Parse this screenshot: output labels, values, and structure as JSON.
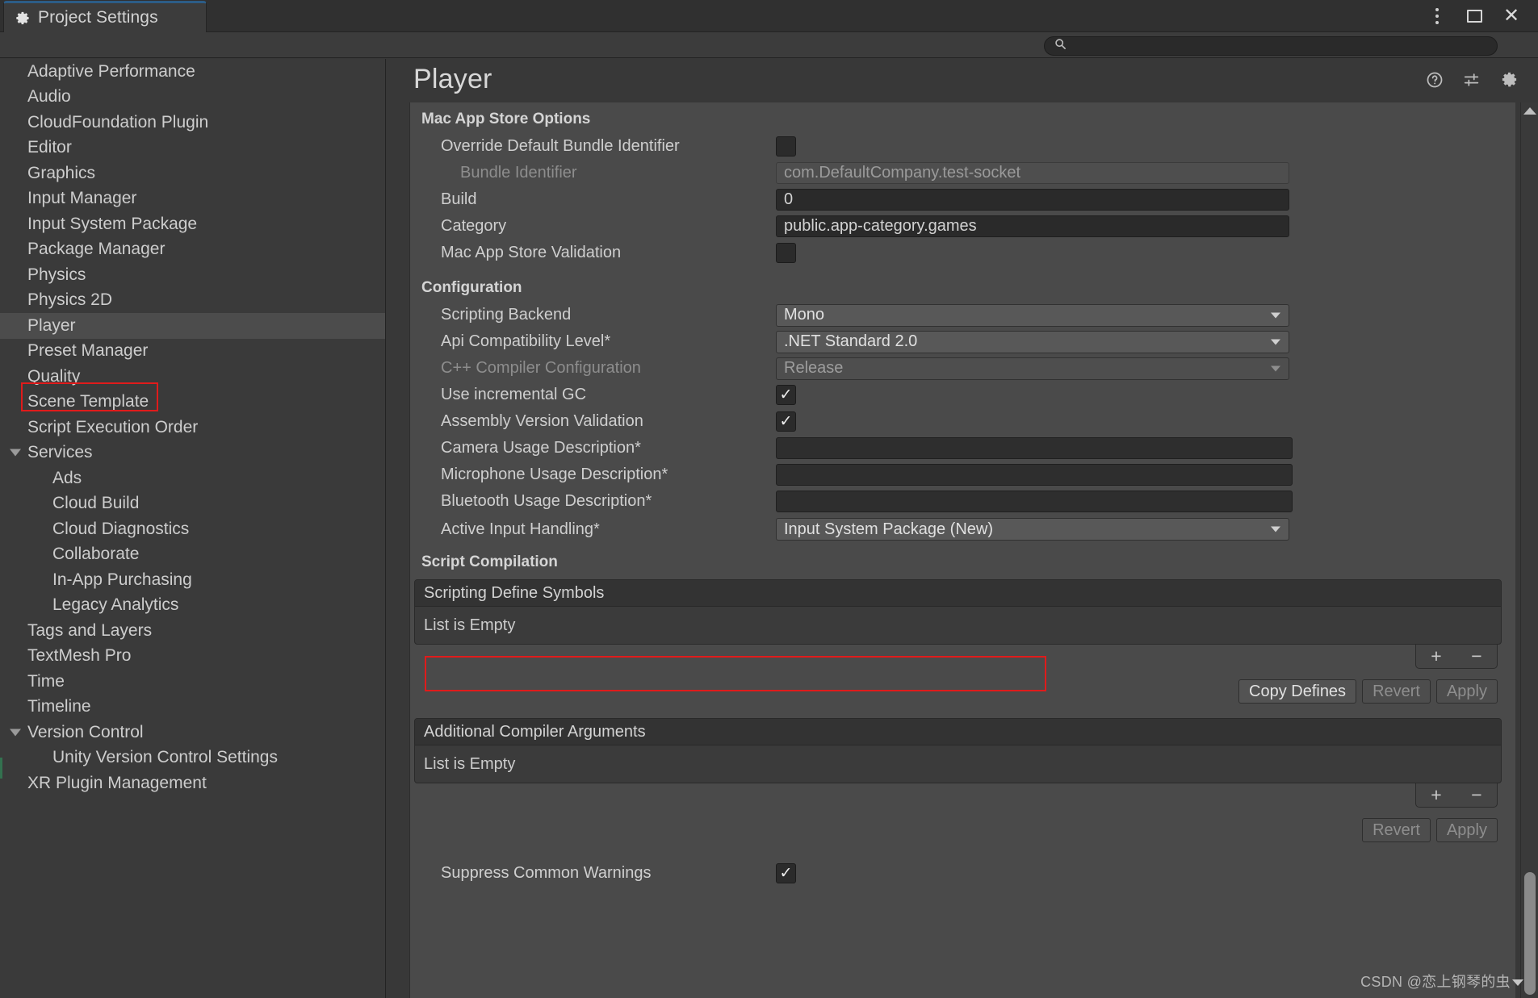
{
  "window": {
    "tab_label": "Project Settings",
    "tab_icon": "gear-icon",
    "controls": {
      "menu": "kebab-menu-icon",
      "maximize": "maximize-icon",
      "close": "close-icon"
    }
  },
  "search": {
    "value": "",
    "placeholder": "",
    "icon": "search-icon"
  },
  "sidebar": {
    "items": [
      {
        "label": "Adaptive Performance",
        "level": 0,
        "expandable": false,
        "selected": false
      },
      {
        "label": "Audio",
        "level": 0,
        "expandable": false,
        "selected": false
      },
      {
        "label": "CloudFoundation Plugin",
        "level": 0,
        "expandable": false,
        "selected": false
      },
      {
        "label": "Editor",
        "level": 0,
        "expandable": false,
        "selected": false
      },
      {
        "label": "Graphics",
        "level": 0,
        "expandable": false,
        "selected": false
      },
      {
        "label": "Input Manager",
        "level": 0,
        "expandable": false,
        "selected": false
      },
      {
        "label": "Input System Package",
        "level": 0,
        "expandable": false,
        "selected": false
      },
      {
        "label": "Package Manager",
        "level": 0,
        "expandable": false,
        "selected": false
      },
      {
        "label": "Physics",
        "level": 0,
        "expandable": false,
        "selected": false
      },
      {
        "label": "Physics 2D",
        "level": 0,
        "expandable": false,
        "selected": false
      },
      {
        "label": "Player",
        "level": 0,
        "expandable": false,
        "selected": true
      },
      {
        "label": "Preset Manager",
        "level": 0,
        "expandable": false,
        "selected": false
      },
      {
        "label": "Quality",
        "level": 0,
        "expandable": false,
        "selected": false
      },
      {
        "label": "Scene Template",
        "level": 0,
        "expandable": false,
        "selected": false
      },
      {
        "label": "Script Execution Order",
        "level": 0,
        "expandable": false,
        "selected": false
      },
      {
        "label": "Services",
        "level": 0,
        "expandable": true,
        "selected": false
      },
      {
        "label": "Ads",
        "level": 1,
        "expandable": false,
        "selected": false
      },
      {
        "label": "Cloud Build",
        "level": 1,
        "expandable": false,
        "selected": false
      },
      {
        "label": "Cloud Diagnostics",
        "level": 1,
        "expandable": false,
        "selected": false
      },
      {
        "label": "Collaborate",
        "level": 1,
        "expandable": false,
        "selected": false
      },
      {
        "label": "In-App Purchasing",
        "level": 1,
        "expandable": false,
        "selected": false
      },
      {
        "label": "Legacy Analytics",
        "level": 1,
        "expandable": false,
        "selected": false
      },
      {
        "label": "Tags and Layers",
        "level": 0,
        "expandable": false,
        "selected": false
      },
      {
        "label": "TextMesh Pro",
        "level": 0,
        "expandable": false,
        "selected": false
      },
      {
        "label": "Time",
        "level": 0,
        "expandable": false,
        "selected": false
      },
      {
        "label": "Timeline",
        "level": 0,
        "expandable": false,
        "selected": false
      },
      {
        "label": "Version Control",
        "level": 0,
        "expandable": true,
        "selected": false
      },
      {
        "label": "Unity Version Control Settings",
        "level": 1,
        "expandable": false,
        "selected": false
      },
      {
        "label": "XR Plugin Management",
        "level": 0,
        "expandable": false,
        "selected": false
      }
    ]
  },
  "panel": {
    "title": "Player",
    "icons": {
      "help": "help-icon",
      "presets": "preset-sliders-icon",
      "settings": "gear-icon"
    }
  },
  "mac_app_store": {
    "heading": "Mac App Store Options",
    "override_bundle_identifier": {
      "label": "Override Default Bundle Identifier",
      "checked": false
    },
    "bundle_identifier": {
      "label": "Bundle Identifier",
      "value": "com.DefaultCompany.test-socket",
      "disabled": true
    },
    "build": {
      "label": "Build",
      "value": "0"
    },
    "category": {
      "label": "Category",
      "value": "public.app-category.games"
    },
    "validation": {
      "label": "Mac App Store Validation",
      "checked": false
    }
  },
  "configuration": {
    "heading": "Configuration",
    "scripting_backend": {
      "label": "Scripting Backend",
      "value": "Mono"
    },
    "api_compatibility": {
      "label": "Api Compatibility Level*",
      "value": ".NET Standard 2.0"
    },
    "cpp_compiler": {
      "label": "C++ Compiler Configuration",
      "value": "Release",
      "disabled": true
    },
    "incremental_gc": {
      "label": "Use incremental GC",
      "checked": true
    },
    "assembly_version_validation": {
      "label": "Assembly Version Validation",
      "checked": true
    },
    "camera_usage": {
      "label": "Camera Usage Description*",
      "value": ""
    },
    "microphone_usage": {
      "label": "Microphone Usage Description*",
      "value": ""
    },
    "bluetooth_usage": {
      "label": "Bluetooth Usage Description*",
      "value": ""
    },
    "active_input_handling": {
      "label": "Active Input Handling*",
      "value": "Input System Package (New)",
      "highlighted": true
    }
  },
  "script_compilation": {
    "heading": "Script Compilation",
    "scripting_define_symbols": {
      "header": "Scripting Define Symbols",
      "empty_text": "List is Empty",
      "add_label": "+",
      "remove_label": "−"
    },
    "buttons": {
      "copy_defines": "Copy Defines",
      "revert": "Revert",
      "apply": "Apply"
    },
    "additional_compiler_arguments": {
      "header": "Additional Compiler Arguments",
      "empty_text": "List is Empty",
      "add_label": "+",
      "remove_label": "−"
    },
    "buttons2": {
      "revert": "Revert",
      "apply": "Apply"
    },
    "suppress_common_warnings": {
      "label": "Suppress Common Warnings",
      "checked": true
    }
  },
  "watermark": {
    "text": "CSDN @恋上钢琴的虫"
  },
  "colors": {
    "accent_tab": "#2c5d87",
    "highlight_red": "#e01b1b",
    "panel_bg": "#4a4a4a",
    "window_bg": "#383838"
  }
}
